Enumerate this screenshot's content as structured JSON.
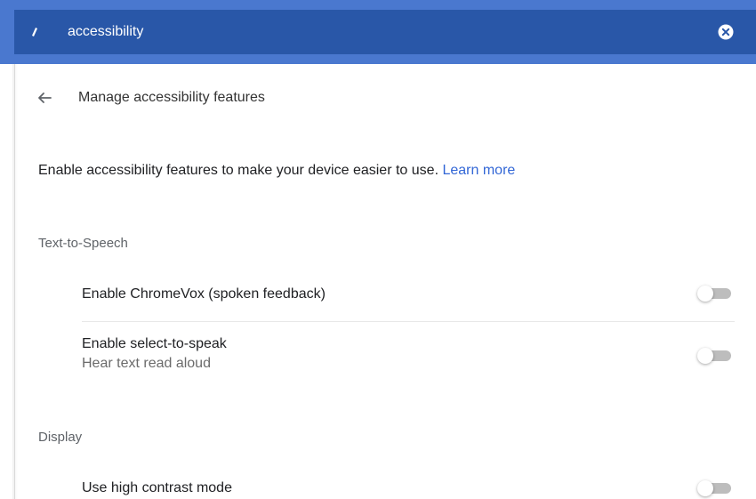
{
  "search": {
    "value": "accessibility",
    "icon": "search-icon",
    "clear_icon": "close-circle-icon"
  },
  "header": {
    "back_icon": "arrow-left-icon",
    "title": "Manage accessibility features"
  },
  "intro": {
    "text": "Enable accessibility features to make your device easier to use.",
    "link": "Learn more"
  },
  "sections": [
    {
      "title": "Text-to-Speech",
      "items": [
        {
          "label": "Enable ChromeVox (spoken feedback)",
          "enabled": false
        },
        {
          "label": "Enable select-to-speak",
          "sublabel": "Hear text read aloud",
          "enabled": false
        }
      ]
    },
    {
      "title": "Display",
      "items": [
        {
          "label": "Use high contrast mode",
          "enabled": false
        }
      ]
    }
  ],
  "colors": {
    "topbar": "#4a78cf",
    "searchbar": "#2957a8",
    "link": "#3367d6",
    "toggle_off_track": "#bdbdbd"
  }
}
